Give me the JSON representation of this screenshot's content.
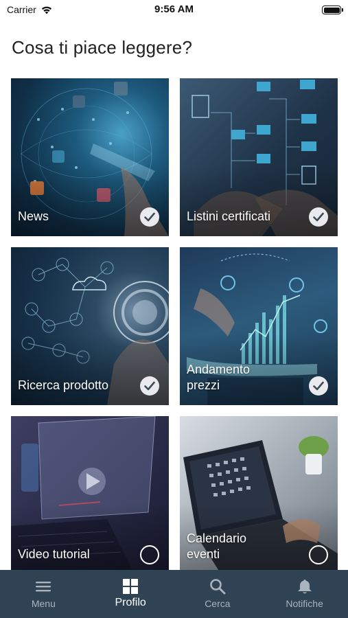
{
  "status_bar": {
    "carrier": "Carrier",
    "time": "9:56 AM"
  },
  "page": {
    "title": "Cosa ti piace leggere?"
  },
  "topics": [
    {
      "label": "News",
      "selected": true,
      "image": "technology-network"
    },
    {
      "label": "Listini certificati",
      "selected": true,
      "image": "document-tree"
    },
    {
      "label": "Ricerca prodotto",
      "selected": true,
      "image": "cloud-network"
    },
    {
      "label": "Andamento\nprezzi",
      "selected": true,
      "image": "price-chart"
    },
    {
      "label": "Video tutorial",
      "selected": false,
      "image": "video-play"
    },
    {
      "label": "Calendario\neventi",
      "selected": false,
      "image": "calendar-laptop"
    }
  ],
  "tab_bar": {
    "tabs": [
      {
        "label": "Menu",
        "icon": "menu-icon",
        "active": false
      },
      {
        "label": "Profilo",
        "icon": "grid-icon",
        "active": true
      },
      {
        "label": "Cerca",
        "icon": "search-icon",
        "active": false
      },
      {
        "label": "Notifiche",
        "icon": "bell-icon",
        "active": false
      }
    ]
  },
  "colors": {
    "tab_bar_bg": "#2f4354",
    "tab_active": "#ffffff",
    "tab_inactive": "#aab4be",
    "check_fill": "#e9e9ee"
  }
}
